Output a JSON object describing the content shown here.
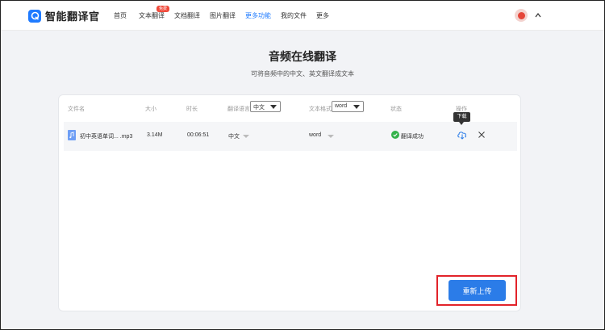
{
  "header": {
    "app_name": "智能翻译官",
    "nav": [
      {
        "label": "首页"
      },
      {
        "label": "文本翻译"
      },
      {
        "label": "文档翻译"
      },
      {
        "label": "图片翻译"
      },
      {
        "label": "更多功能"
      },
      {
        "label": "我的文件"
      },
      {
        "label": "更多"
      }
    ],
    "badge": "免费",
    "active_nav": "更多功能",
    "accent_color": "#1f7bff"
  },
  "page": {
    "title": "音频在线翻译",
    "subtitle": "可将音频中的中文、英文翻译成文本"
  },
  "table": {
    "columns": {
      "filename": "文件名",
      "size": "大小",
      "duration": "时长",
      "language": "翻译语言",
      "format": "文本格式",
      "status": "状态",
      "actions": "操作"
    },
    "language_select": "中文",
    "format_select": "word",
    "rows": [
      {
        "filename": "初中英语单词... .mp3",
        "size": "3.14M",
        "duration": "00:06:51",
        "language": "中文",
        "format": "word",
        "status": "翻译成功"
      }
    ],
    "status_color": "#34b24a"
  },
  "tooltip": "下载",
  "reupload_button": "重新上传",
  "button_color": "#2b7ce8",
  "highlight_color": "#e2232a"
}
